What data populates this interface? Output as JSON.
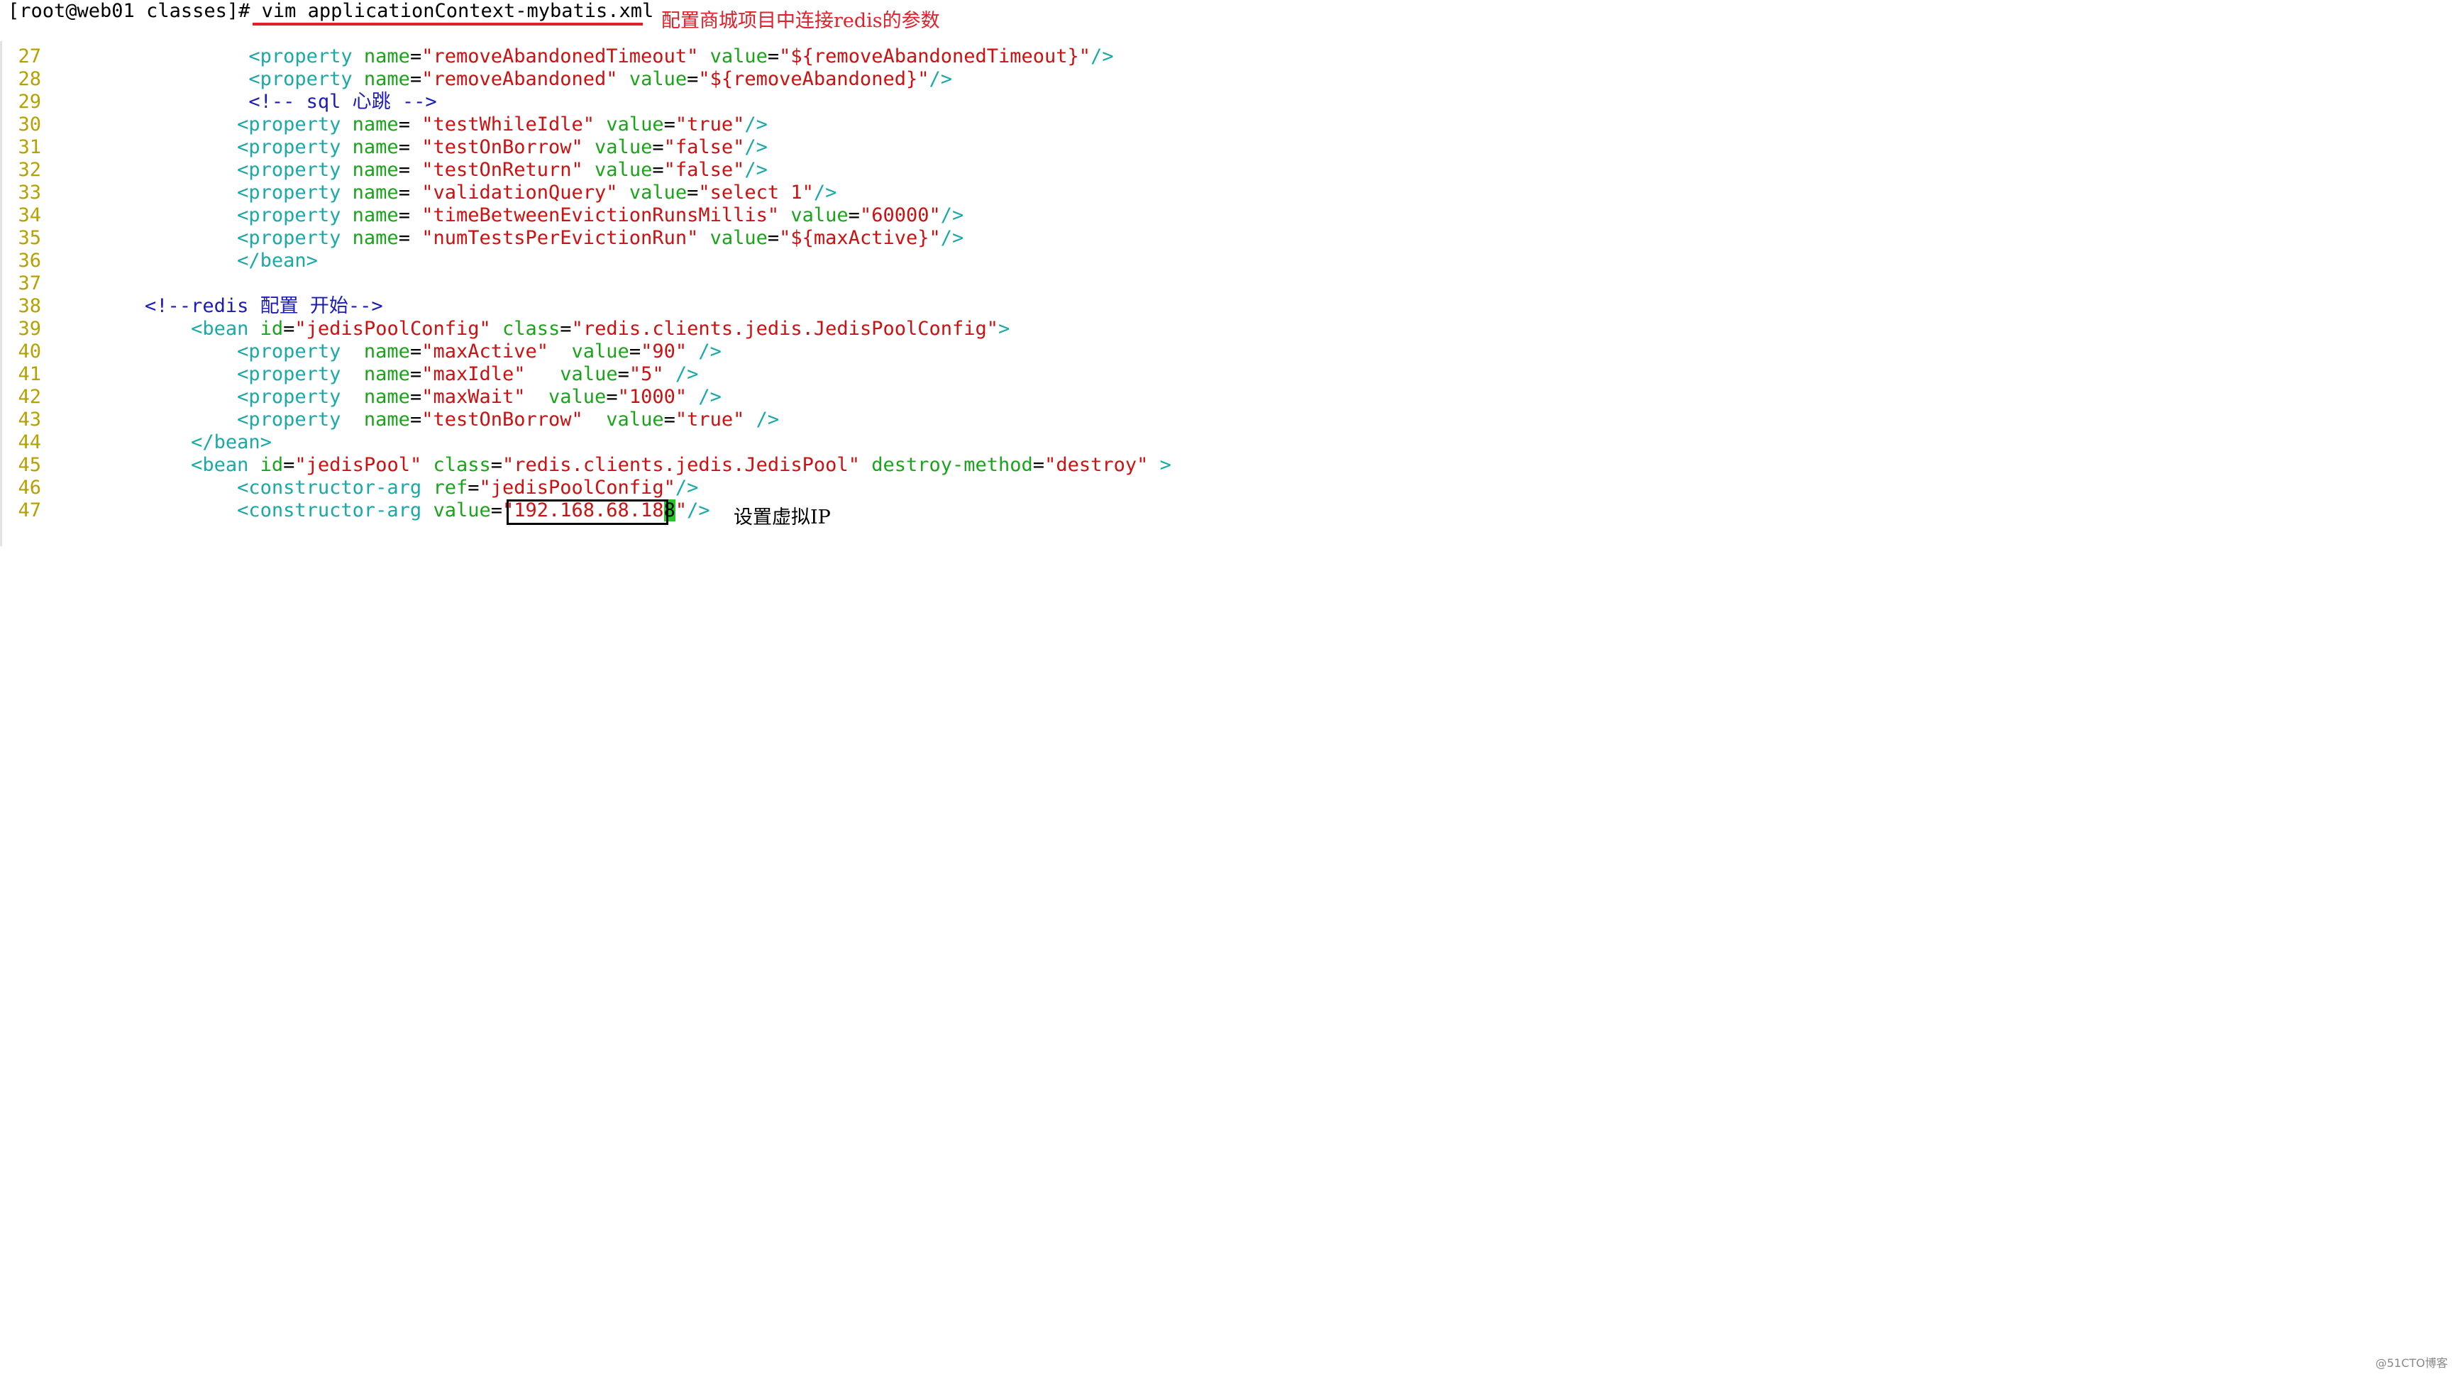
{
  "prompt": "[root@web01 classes]# ",
  "command": "vim applicationContext-mybatis.xml",
  "annotation_top": "配置商城项目中连接redis的参数",
  "annotation_ip": "设置虚拟IP",
  "watermark": "@51CTO博客",
  "colors": {
    "tag": "#19a9a9",
    "attr": "#1aa41a",
    "string": "#cc1111",
    "comment": "#1b1bb5",
    "line_number": "#b5a200",
    "annotation_red": "#e0202a",
    "cursor": "#26c626"
  },
  "lines": [
    {
      "n": "27",
      "tokens": [
        [
          "",
          "                 "
        ],
        [
          "tag",
          "<property "
        ],
        [
          "attr",
          "name"
        ],
        [
          "eq",
          "="
        ],
        [
          "str",
          "\"removeAbandonedTimeout\""
        ],
        [
          "eq",
          " "
        ],
        [
          "attr",
          "value"
        ],
        [
          "eq",
          "="
        ],
        [
          "str",
          "\"${removeAbandonedTimeout}\""
        ],
        [
          "tag",
          "/>"
        ]
      ]
    },
    {
      "n": "28",
      "tokens": [
        [
          "",
          "                 "
        ],
        [
          "tag",
          "<property "
        ],
        [
          "attr",
          "name"
        ],
        [
          "eq",
          "="
        ],
        [
          "str",
          "\"removeAbandoned\""
        ],
        [
          "eq",
          " "
        ],
        [
          "attr",
          "value"
        ],
        [
          "eq",
          "="
        ],
        [
          "str",
          "\"${removeAbandoned}\""
        ],
        [
          "tag",
          "/>"
        ]
      ]
    },
    {
      "n": "29",
      "tokens": [
        [
          "",
          "                 "
        ],
        [
          "cmt",
          "<!-- sql 心跳 -->"
        ]
      ]
    },
    {
      "n": "30",
      "tokens": [
        [
          "",
          "                "
        ],
        [
          "tag",
          "<property "
        ],
        [
          "attr",
          "name"
        ],
        [
          "eq",
          "= "
        ],
        [
          "str",
          "\"testWhileIdle\""
        ],
        [
          "eq",
          " "
        ],
        [
          "attr",
          "value"
        ],
        [
          "eq",
          "="
        ],
        [
          "str",
          "\"true\""
        ],
        [
          "tag",
          "/>"
        ]
      ]
    },
    {
      "n": "31",
      "tokens": [
        [
          "",
          "                "
        ],
        [
          "tag",
          "<property "
        ],
        [
          "attr",
          "name"
        ],
        [
          "eq",
          "= "
        ],
        [
          "str",
          "\"testOnBorrow\""
        ],
        [
          "eq",
          " "
        ],
        [
          "attr",
          "value"
        ],
        [
          "eq",
          "="
        ],
        [
          "str",
          "\"false\""
        ],
        [
          "tag",
          "/>"
        ]
      ]
    },
    {
      "n": "32",
      "tokens": [
        [
          "",
          "                "
        ],
        [
          "tag",
          "<property "
        ],
        [
          "attr",
          "name"
        ],
        [
          "eq",
          "= "
        ],
        [
          "str",
          "\"testOnReturn\""
        ],
        [
          "eq",
          " "
        ],
        [
          "attr",
          "value"
        ],
        [
          "eq",
          "="
        ],
        [
          "str",
          "\"false\""
        ],
        [
          "tag",
          "/>"
        ]
      ]
    },
    {
      "n": "33",
      "tokens": [
        [
          "",
          "                "
        ],
        [
          "tag",
          "<property "
        ],
        [
          "attr",
          "name"
        ],
        [
          "eq",
          "= "
        ],
        [
          "str",
          "\"validationQuery\""
        ],
        [
          "eq",
          " "
        ],
        [
          "attr",
          "value"
        ],
        [
          "eq",
          "="
        ],
        [
          "str",
          "\"select 1\""
        ],
        [
          "tag",
          "/>"
        ]
      ]
    },
    {
      "n": "34",
      "tokens": [
        [
          "",
          "                "
        ],
        [
          "tag",
          "<property "
        ],
        [
          "attr",
          "name"
        ],
        [
          "eq",
          "= "
        ],
        [
          "str",
          "\"timeBetweenEvictionRunsMillis\""
        ],
        [
          "eq",
          " "
        ],
        [
          "attr",
          "value"
        ],
        [
          "eq",
          "="
        ],
        [
          "str",
          "\"60000\""
        ],
        [
          "tag",
          "/>"
        ]
      ]
    },
    {
      "n": "35",
      "tokens": [
        [
          "",
          "                "
        ],
        [
          "tag",
          "<property "
        ],
        [
          "attr",
          "name"
        ],
        [
          "eq",
          "= "
        ],
        [
          "str",
          "\"numTestsPerEvictionRun\""
        ],
        [
          "eq",
          " "
        ],
        [
          "attr",
          "value"
        ],
        [
          "eq",
          "="
        ],
        [
          "str",
          "\"${maxActive}\""
        ],
        [
          "tag",
          "/>"
        ]
      ]
    },
    {
      "n": "36",
      "tokens": [
        [
          "",
          "                "
        ],
        [
          "tag",
          "</bean>"
        ]
      ]
    },
    {
      "n": "37",
      "tokens": []
    },
    {
      "n": "38",
      "tokens": [
        [
          "",
          "        "
        ],
        [
          "cmt",
          "<!--redis 配置 开始-->"
        ]
      ]
    },
    {
      "n": "39",
      "tokens": [
        [
          "",
          "            "
        ],
        [
          "tag",
          "<bean "
        ],
        [
          "attr",
          "id"
        ],
        [
          "eq",
          "="
        ],
        [
          "str",
          "\"jedisPoolConfig\""
        ],
        [
          "eq",
          " "
        ],
        [
          "attr",
          "class"
        ],
        [
          "eq",
          "="
        ],
        [
          "str",
          "\"redis.clients.jedis.JedisPoolConfig\""
        ],
        [
          "tag",
          ">"
        ]
      ]
    },
    {
      "n": "40",
      "tokens": [
        [
          "",
          "                "
        ],
        [
          "tag",
          "<property  "
        ],
        [
          "attr",
          "name"
        ],
        [
          "eq",
          "="
        ],
        [
          "str",
          "\"maxActive\""
        ],
        [
          "eq",
          "  "
        ],
        [
          "attr",
          "value"
        ],
        [
          "eq",
          "="
        ],
        [
          "str",
          "\"90\""
        ],
        [
          "eq",
          " "
        ],
        [
          "tag",
          "/>"
        ]
      ]
    },
    {
      "n": "41",
      "tokens": [
        [
          "",
          "                "
        ],
        [
          "tag",
          "<property  "
        ],
        [
          "attr",
          "name"
        ],
        [
          "eq",
          "="
        ],
        [
          "str",
          "\"maxIdle\""
        ],
        [
          "eq",
          "   "
        ],
        [
          "attr",
          "value"
        ],
        [
          "eq",
          "="
        ],
        [
          "str",
          "\"5\""
        ],
        [
          "eq",
          " "
        ],
        [
          "tag",
          "/>"
        ]
      ]
    },
    {
      "n": "42",
      "tokens": [
        [
          "",
          "                "
        ],
        [
          "tag",
          "<property  "
        ],
        [
          "attr",
          "name"
        ],
        [
          "eq",
          "="
        ],
        [
          "str",
          "\"maxWait\""
        ],
        [
          "eq",
          "  "
        ],
        [
          "attr",
          "value"
        ],
        [
          "eq",
          "="
        ],
        [
          "str",
          "\"1000\""
        ],
        [
          "eq",
          " "
        ],
        [
          "tag",
          "/>"
        ]
      ]
    },
    {
      "n": "43",
      "tokens": [
        [
          "",
          "                "
        ],
        [
          "tag",
          "<property  "
        ],
        [
          "attr",
          "name"
        ],
        [
          "eq",
          "="
        ],
        [
          "str",
          "\"testOnBorrow\""
        ],
        [
          "eq",
          "  "
        ],
        [
          "attr",
          "value"
        ],
        [
          "eq",
          "="
        ],
        [
          "str",
          "\"true\""
        ],
        [
          "eq",
          " "
        ],
        [
          "tag",
          "/>"
        ]
      ]
    },
    {
      "n": "44",
      "tokens": [
        [
          "",
          "            "
        ],
        [
          "tag",
          "</bean>"
        ]
      ]
    },
    {
      "n": "45",
      "tokens": [
        [
          "",
          "            "
        ],
        [
          "tag",
          "<bean "
        ],
        [
          "attr",
          "id"
        ],
        [
          "eq",
          "="
        ],
        [
          "str",
          "\"jedisPool\""
        ],
        [
          "eq",
          " "
        ],
        [
          "attr",
          "class"
        ],
        [
          "eq",
          "="
        ],
        [
          "str",
          "\"redis.clients.jedis.JedisPool\""
        ],
        [
          "eq",
          " "
        ],
        [
          "attr",
          "destroy-method"
        ],
        [
          "eq",
          "="
        ],
        [
          "str",
          "\"destroy\""
        ],
        [
          "eq",
          " "
        ],
        [
          "tag",
          ">"
        ]
      ]
    },
    {
      "n": "46",
      "tokens": [
        [
          "",
          "                "
        ],
        [
          "tag",
          "<constructor-arg "
        ],
        [
          "attr",
          "ref"
        ],
        [
          "eq",
          "="
        ],
        [
          "str",
          "\"jedisPoolConfig\""
        ],
        [
          "tag",
          "/>"
        ]
      ]
    },
    {
      "n": "47",
      "tokens": [
        [
          "",
          "                "
        ],
        [
          "tag",
          "<constructor-arg "
        ],
        [
          "attr",
          "value"
        ],
        [
          "eq",
          "="
        ],
        [
          "str",
          "\"192.168.68.18"
        ],
        [
          "cursor",
          "8"
        ],
        [
          "str",
          "\""
        ],
        [
          "tag",
          "/>"
        ]
      ]
    }
  ]
}
